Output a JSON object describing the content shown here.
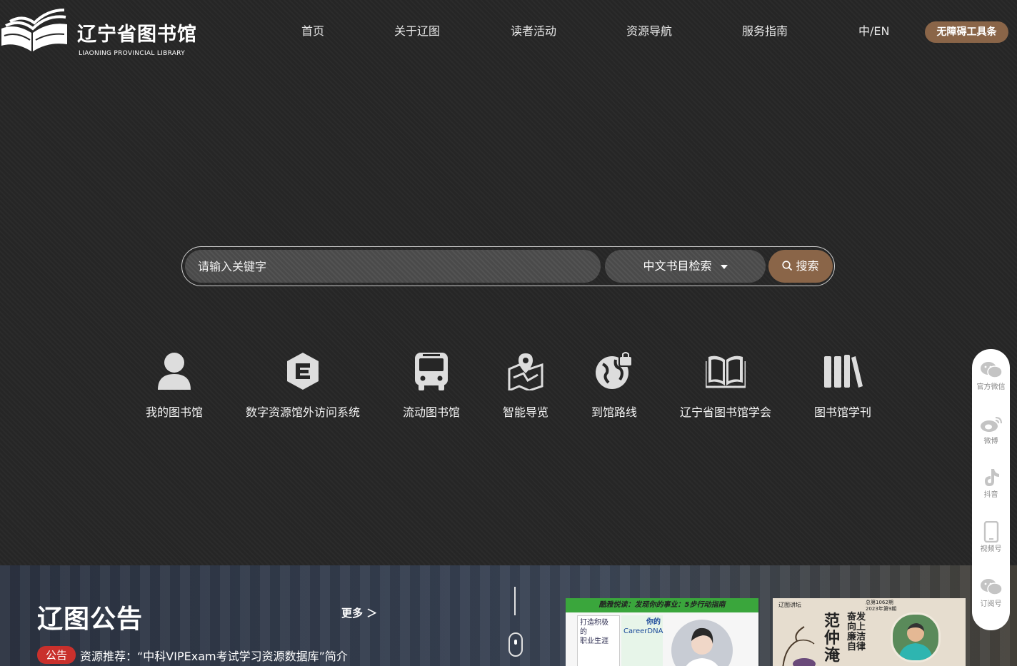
{
  "header": {
    "logo_cn": "辽宁省图书馆",
    "logo_en": "LIAONING PROVINCIAL LIBRARY",
    "nav": [
      "首页",
      "关于辽图",
      "读者活动",
      "资源导航",
      "服务指南",
      "中/EN"
    ],
    "tool_button": "无障碍工具条"
  },
  "search": {
    "placeholder": "请输入关键字",
    "type_selected": "中文书目检索",
    "button_label": "搜索"
  },
  "quick_links": [
    {
      "label": "我的图书馆",
      "icon": "user-icon"
    },
    {
      "label": "数字资源馆外访问系统",
      "icon": "e-resource-icon"
    },
    {
      "label": "流动图书馆",
      "icon": "bus-icon"
    },
    {
      "label": "智能导览",
      "icon": "map-guide-icon"
    },
    {
      "label": "到馆路线",
      "icon": "route-globe-icon"
    },
    {
      "label": "辽宁省图书馆学会",
      "icon": "open-book-icon"
    },
    {
      "label": "图书馆学刊",
      "icon": "journals-icon"
    }
  ],
  "notice": {
    "title": "辽图公告",
    "more": "更多 ＞",
    "badge": "公告",
    "text": "资源推荐：“中科VIPExam考试学习资源数据库”简介"
  },
  "cards": {
    "card1": {
      "banner": "酷雅悦读：发现你的事业：5步行动指南",
      "book1": [
        "打造积极",
        "的",
        "职业生涯"
      ],
      "book2": [
        "你的",
        "CareerDNA"
      ]
    },
    "card2": {
      "tag": "辽图讲坛",
      "date": [
        "总第1062期",
        "2023年第9期"
      ],
      "big": "范仲淹",
      "sub": "奋发向上 廉洁自律"
    }
  },
  "social": [
    {
      "label": "官方微信",
      "icon": "wechat-icon"
    },
    {
      "label": "微博",
      "icon": "weibo-icon"
    },
    {
      "label": "抖音",
      "icon": "douyin-icon"
    },
    {
      "label": "视频号",
      "icon": "phone-video-icon"
    },
    {
      "label": "订阅号",
      "icon": "wechat-subscription-icon"
    }
  ],
  "colors": {
    "accent": "#8a6548",
    "badge": "#c9302c",
    "background": "#262626"
  }
}
